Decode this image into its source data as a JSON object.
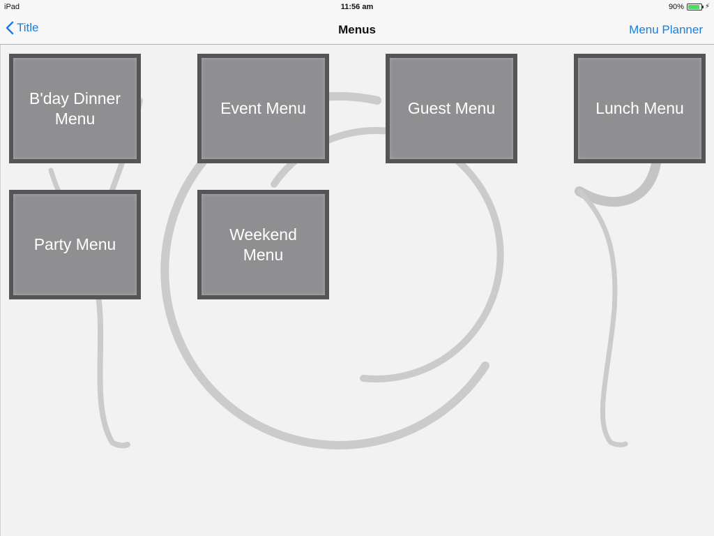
{
  "status_bar": {
    "device": "iPad",
    "time": "11:56 am",
    "battery_percent": "90%",
    "battery_level": 0.9
  },
  "nav": {
    "back_label": "Title",
    "title": "Menus",
    "right_label": "Menu Planner"
  },
  "menus": [
    {
      "label": "B'day Dinner Menu"
    },
    {
      "label": "Event Menu"
    },
    {
      "label": "Guest Menu"
    },
    {
      "label": "Lunch Menu"
    },
    {
      "label": "Party Menu"
    },
    {
      "label": "Weekend Menu"
    }
  ],
  "colors": {
    "accent": "#1a7de0",
    "tile_fill": "#8f8e90",
    "tile_border": "#555456",
    "battery": "#4cd964"
  },
  "icons": {
    "back": "chevron-left-icon",
    "charging": "lightning-bolt-icon"
  }
}
